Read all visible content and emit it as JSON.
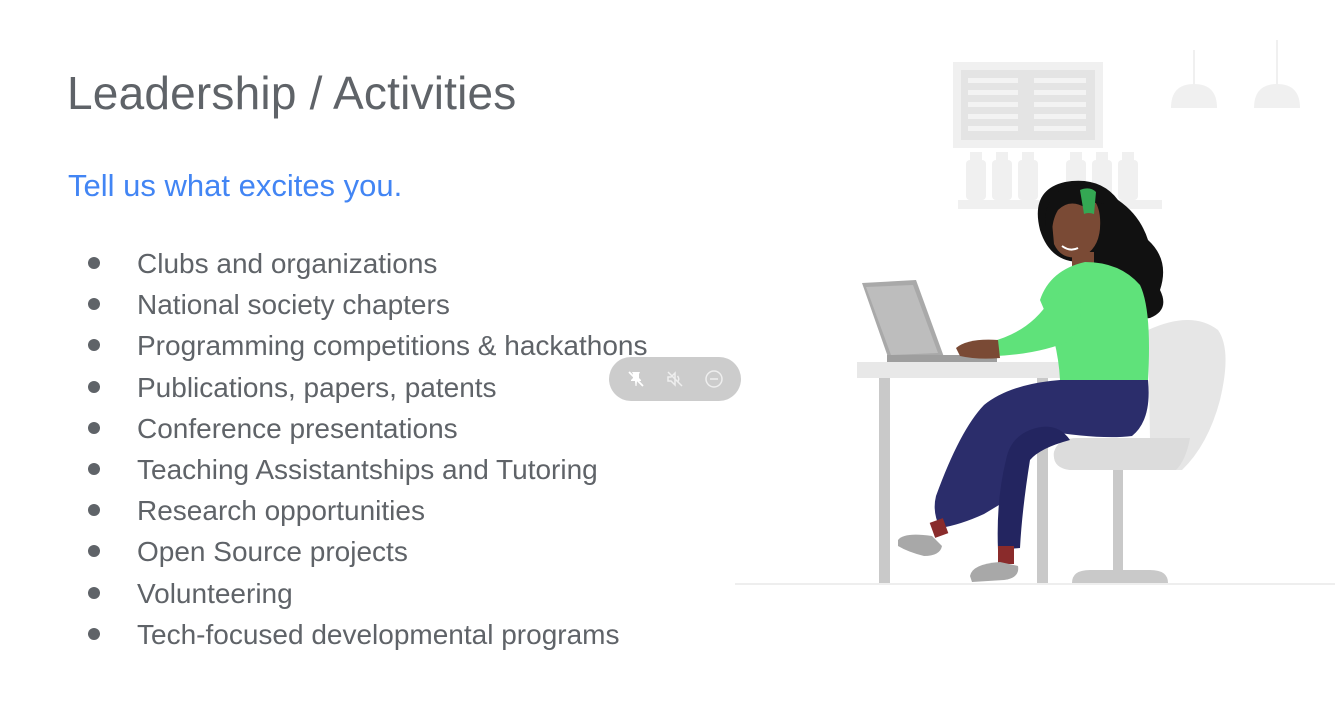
{
  "slide": {
    "title": "Leadership / Activities",
    "subtitle": "Tell us what excites you.",
    "bullets": [
      "Clubs and organizations",
      "National society chapters",
      "Programming competitions & hackathons",
      "Publications, papers, patents",
      "Conference presentations",
      "Teaching Assistantships and Tutoring",
      "Research opportunities",
      "Open Source projects",
      "Volunteering",
      "Tech-focused developmental programs"
    ]
  },
  "media_controls": {
    "icons": [
      "pin-off-icon",
      "mute-icon",
      "minimize-icon"
    ]
  },
  "colors": {
    "title": "#5f6368",
    "subtitle": "#4285f4",
    "bullet_text": "#5f6368",
    "shirt": "#5fe27a",
    "headband": "#34a853",
    "pants": "#2b2d6b"
  }
}
